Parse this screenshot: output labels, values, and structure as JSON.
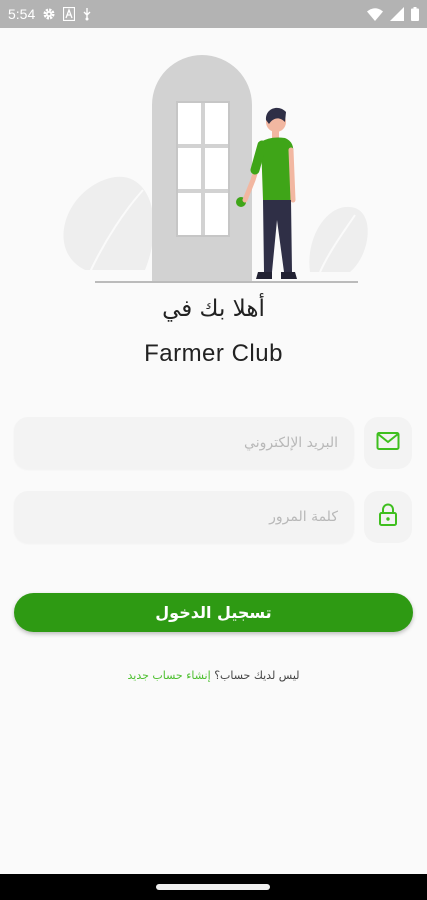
{
  "status_bar": {
    "time": "5:54",
    "left_icons": [
      "gear-icon",
      "a-notification-icon",
      "usb-debug-icon"
    ],
    "right_icons": [
      "wifi-icon",
      "signal-icon",
      "battery-icon"
    ]
  },
  "welcome": {
    "line1": "أهلا بك في",
    "line2": "Farmer Club"
  },
  "email": {
    "placeholder": "البريد الإلكتروني",
    "value": "",
    "icon": "mail-icon"
  },
  "password": {
    "placeholder": "كلمة المرور",
    "value": "",
    "icon": "lock-icon"
  },
  "login_button": {
    "label": "تسجيل الدخول"
  },
  "signup": {
    "question": "ليس لديك حساب؟",
    "link": "إنشاء حساب جديد"
  },
  "colors": {
    "accent": "#2e9a13",
    "link": "#4cbf2e",
    "shirt": "#3fa518",
    "status_bar": "#b3b3b3"
  }
}
